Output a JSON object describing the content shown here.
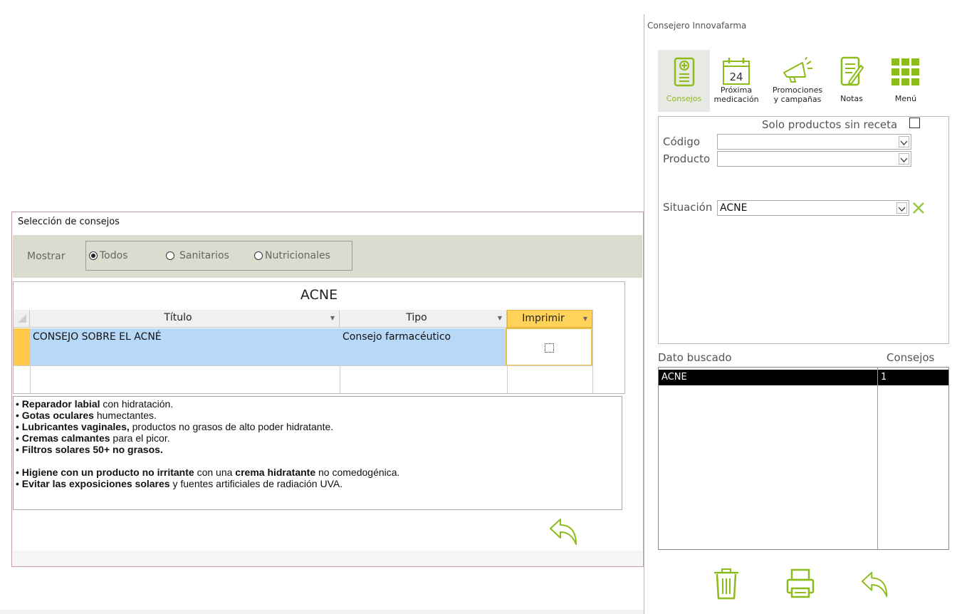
{
  "selection_window": {
    "title": "Selección de consejos",
    "filter": {
      "label": "Mostrar",
      "options": [
        {
          "label": "Todos",
          "selected": true
        },
        {
          "label": "Sanitarios",
          "selected": false
        },
        {
          "label": "Nutricionales",
          "selected": false
        }
      ]
    },
    "grid": {
      "caption": "ACNE",
      "columns": [
        "Título",
        "Tipo",
        "Imprimir"
      ],
      "rows": [
        {
          "titulo": "CONSEJO SOBRE EL ACNÉ",
          "tipo": "Consejo farmacéutico",
          "imprimir": false
        }
      ]
    },
    "advice_lines": [
      {
        "bold": "Reparador labial",
        "rest": " con hidratación."
      },
      {
        "bold": "Gotas oculares",
        "rest": " humectantes."
      },
      {
        "bold": "Lubricantes vaginales,",
        "rest": " productos no grasos de alto poder hidratante."
      },
      {
        "bold": "Cremas calmantes",
        "rest": " para el picor."
      },
      {
        "bold": "Filtros solares 50+ no grasos.",
        "rest": ""
      },
      {
        "bold": "Higiene con un producto no irritante",
        "rest": " con una ",
        "bold2": "crema hidratante",
        "rest2": " no comedogénica."
      },
      {
        "bold": "Evitar las exposiciones solares",
        "rest": " y fuentes artificiales de radiación UVA."
      }
    ],
    "bullet": "•"
  },
  "right_window": {
    "title": "Consejero Innovafarma",
    "toolbar": [
      {
        "label": "Consejos",
        "icon": "document-plus-icon",
        "active": true
      },
      {
        "label": "Próxima\nmedicación",
        "icon": "calendar-24-icon",
        "calendar_day": "24",
        "active": false
      },
      {
        "label": "Promociones\ny campañas",
        "icon": "megaphone-icon",
        "active": false
      },
      {
        "label": "Notas",
        "icon": "notes-icon",
        "active": false
      },
      {
        "label": "Menú",
        "icon": "grid-menu-icon",
        "active": false
      }
    ],
    "filters": {
      "solo_sin_receta_label": "Solo productos sin receta",
      "solo_sin_receta_checked": false,
      "codigo_label": "Código",
      "codigo_value": "",
      "producto_label": "Producto",
      "producto_value": "",
      "situacion_label": "Situación",
      "situacion_value": "ACNE"
    },
    "results": {
      "col_dato": "Dato buscado",
      "col_consejos": "Consejos",
      "rows": [
        {
          "dato": "ACNE",
          "consejos": "1"
        }
      ]
    },
    "bottom_actions": [
      "trash-icon",
      "printer-icon",
      "undo-icon"
    ]
  },
  "colors": {
    "accent_green": "#8cbc1a",
    "selected_row": "#b8d8f8",
    "imprimir_header": "#ffd35a",
    "band_gray": "#dcdbd0"
  }
}
